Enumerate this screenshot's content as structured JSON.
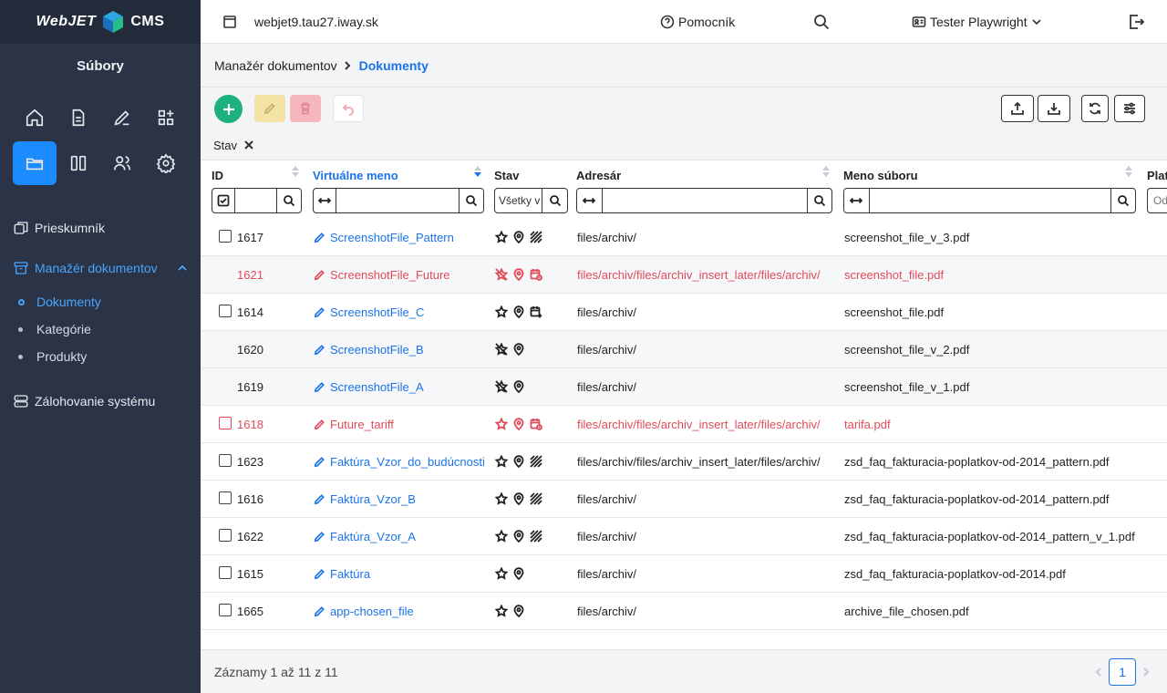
{
  "app": {
    "logo_left": "WebJET",
    "logo_right": "CMS",
    "section_title": "Súbory"
  },
  "sidebar": {
    "icons": [
      "home-icon",
      "document-icon",
      "edit-icon",
      "apps-add-icon",
      "folder-icon",
      "columns-icon",
      "users-icon",
      "gear-icon"
    ],
    "nav": [
      {
        "label": "Prieskumník",
        "icon": "layers-icon"
      },
      {
        "label": "Manažér dokumentov",
        "icon": "archive-icon",
        "active": true
      },
      {
        "label": "Zálohovanie systému",
        "icon": "server-icon"
      }
    ],
    "subnav": [
      {
        "label": "Dokumenty",
        "active": true
      },
      {
        "label": "Kategórie"
      },
      {
        "label": "Produkty"
      }
    ]
  },
  "topbar": {
    "site": "webjet9.tau27.iway.sk",
    "help": "Pomocník",
    "user": "Tester Playwright"
  },
  "breadcrumb": {
    "parent": "Manažér dokumentov",
    "current": "Dokumenty"
  },
  "filter_chip": "Stav",
  "table": {
    "columns": {
      "id": "ID",
      "name": "Virtuálne meno",
      "state": "Stav",
      "dir": "Adresár",
      "file": "Meno súboru",
      "valid": "Plat"
    },
    "state_select": "Všetky v",
    "valid_placeholder": "Od",
    "rows": [
      {
        "id": "1617",
        "name": "ScreenshotFile_Pattern",
        "icons": [
          "star",
          "pin",
          "hatch"
        ],
        "dir": "files/archiv/",
        "file": "screenshot_file_v_3.pdf",
        "red": false,
        "alt": false,
        "checkbox": true
      },
      {
        "id": "1621",
        "name": "ScreenshotFile_Future",
        "icons": [
          "star-off",
          "pin",
          "cal-clock"
        ],
        "dir": "files/archiv/files/archiv_insert_later/files/archiv/",
        "file": "screenshot_file.pdf",
        "red": true,
        "alt": true,
        "checkbox": false
      },
      {
        "id": "1614",
        "name": "ScreenshotFile_C",
        "icons": [
          "star",
          "pin",
          "cal-plus"
        ],
        "dir": "files/archiv/",
        "file": "screenshot_file.pdf",
        "red": false,
        "alt": false,
        "checkbox": true
      },
      {
        "id": "1620",
        "name": "ScreenshotFile_B",
        "icons": [
          "star-off",
          "pin"
        ],
        "dir": "files/archiv/",
        "file": "screenshot_file_v_2.pdf",
        "red": false,
        "alt": true,
        "checkbox": false
      },
      {
        "id": "1619",
        "name": "ScreenshotFile_A",
        "icons": [
          "star-off",
          "pin"
        ],
        "dir": "files/archiv/",
        "file": "screenshot_file_v_1.pdf",
        "red": false,
        "alt": true,
        "checkbox": false
      },
      {
        "id": "1618",
        "name": "Future_tariff",
        "icons": [
          "star",
          "pin",
          "cal-clock"
        ],
        "dir": "files/archiv/files/archiv_insert_later/files/archiv/",
        "file": "tarifa.pdf",
        "red": true,
        "alt": false,
        "checkbox": true
      },
      {
        "id": "1623",
        "name": "Faktúra_Vzor_do_budúcnosti",
        "icons": [
          "star",
          "pin",
          "hatch"
        ],
        "dir": "files/archiv/files/archiv_insert_later/files/archiv/",
        "file": "zsd_faq_fakturacia-poplatkov-od-2014_pattern.pdf",
        "red": false,
        "alt": false,
        "checkbox": true
      },
      {
        "id": "1616",
        "name": "Faktúra_Vzor_B",
        "icons": [
          "star",
          "pin",
          "hatch"
        ],
        "dir": "files/archiv/",
        "file": "zsd_faq_fakturacia-poplatkov-od-2014_pattern.pdf",
        "red": false,
        "alt": false,
        "checkbox": true
      },
      {
        "id": "1622",
        "name": "Faktúra_Vzor_A",
        "icons": [
          "star",
          "pin",
          "hatch"
        ],
        "dir": "files/archiv/",
        "file": "zsd_faq_fakturacia-poplatkov-od-2014_pattern_v_1.pdf",
        "red": false,
        "alt": false,
        "checkbox": true
      },
      {
        "id": "1615",
        "name": "Faktúra",
        "icons": [
          "star",
          "pin"
        ],
        "dir": "files/archiv/",
        "file": "zsd_faq_fakturacia-poplatkov-od-2014.pdf",
        "red": false,
        "alt": false,
        "checkbox": true
      },
      {
        "id": "1665",
        "name": "app-chosen_file",
        "icons": [
          "star",
          "pin"
        ],
        "dir": "files/archiv/",
        "file": "archive_file_chosen.pdf",
        "red": false,
        "alt": false,
        "checkbox": true
      }
    ]
  },
  "footer": {
    "summary": "Záznamy 1 až 11 z 11",
    "page": "1"
  },
  "colors": {
    "sidebar_bg": "#2b3446",
    "accent": "#1a8cff",
    "link": "#1a73e8",
    "danger": "#e04b5a",
    "add": "#1cb17e"
  }
}
